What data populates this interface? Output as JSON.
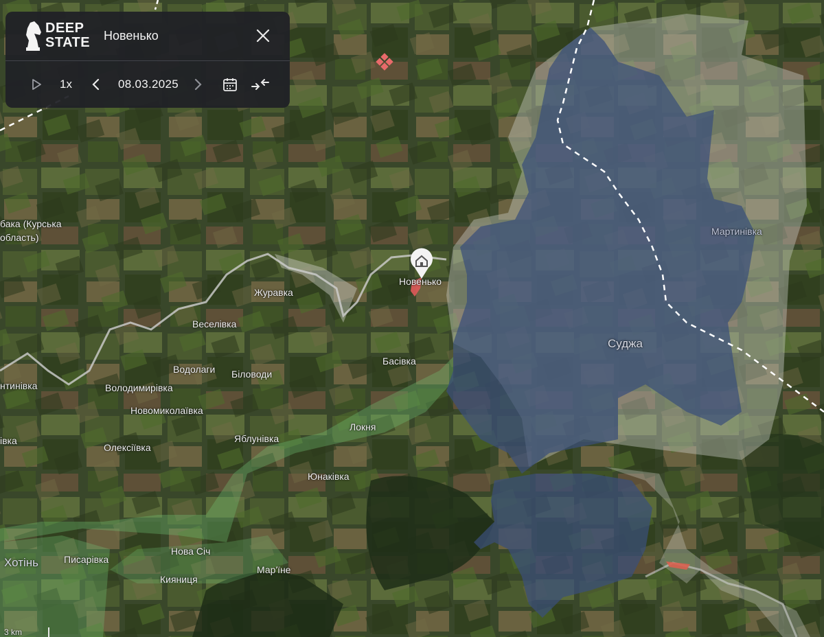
{
  "panel": {
    "logo_line1": "DEEP",
    "logo_line2": "STATE",
    "title": "Новенько",
    "speed": "1x",
    "date": "08.03.2025"
  },
  "icons": {
    "logo": "knight-chess-icon",
    "close": "close-icon",
    "play": "play-icon",
    "prev": "chevron-left-icon",
    "next": "chevron-right-icon",
    "calendar": "calendar-icon",
    "collapse": "arrows-collapse-icon",
    "pin": "home-pin-icon"
  },
  "places": [
    {
      "name": "бака (Курська",
      "cls": ""
    },
    {
      "name": "область)",
      "cls": ""
    },
    {
      "name": "Журавка",
      "cls": ""
    },
    {
      "name": "Веселівка",
      "cls": ""
    },
    {
      "name": "Новенько",
      "cls": ""
    },
    {
      "name": "Басівка",
      "cls": ""
    },
    {
      "name": "Водолаги",
      "cls": ""
    },
    {
      "name": "Біловоди",
      "cls": ""
    },
    {
      "name": "Володимирівка",
      "cls": ""
    },
    {
      "name": "нтинівка",
      "cls": ""
    },
    {
      "name": "Новомиколаївка",
      "cls": ""
    },
    {
      "name": "Яблунівка",
      "cls": ""
    },
    {
      "name": "Локня",
      "cls": ""
    },
    {
      "name": "Олексіївка",
      "cls": ""
    },
    {
      "name": "івка",
      "cls": ""
    },
    {
      "name": "Юнаківка",
      "cls": ""
    },
    {
      "name": "Суджа",
      "cls": "big"
    },
    {
      "name": "Мартинівка",
      "cls": "muted"
    },
    {
      "name": "Хотінь",
      "cls": "big"
    },
    {
      "name": "Писарівка",
      "cls": ""
    },
    {
      "name": "Нова Січ",
      "cls": ""
    },
    {
      "name": "Мар'їне",
      "cls": ""
    },
    {
      "name": "Кияниця",
      "cls": ""
    }
  ],
  "scale": "3 km",
  "colors": {
    "occupied": "#3a4f7a",
    "gray_zone": "#c9cbc3",
    "liberated": "#6fbf73",
    "ua_advance": "#e05a5a",
    "border_line": "#ffffff"
  }
}
